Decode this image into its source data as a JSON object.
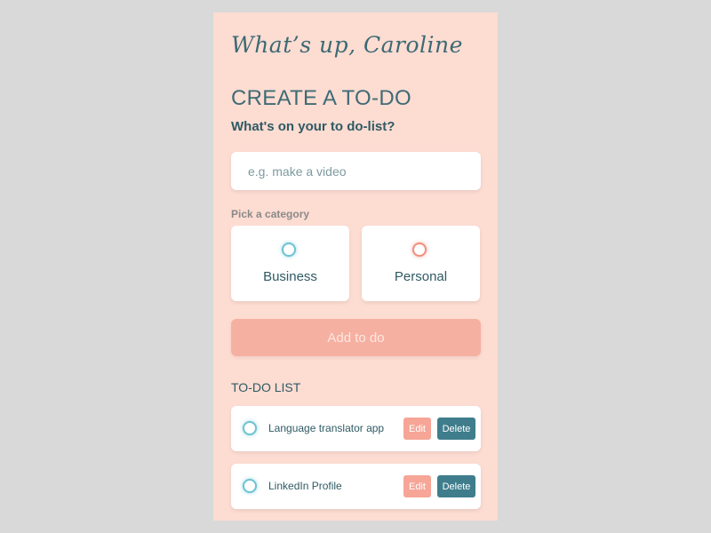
{
  "header": {
    "greeting": "What’s up, Caroline"
  },
  "create": {
    "title": "CREATE A TO-DO",
    "subtitle": "What's on your to do-list?",
    "input_placeholder": "e.g. make a video",
    "input_value": ""
  },
  "category": {
    "label": "Pick a category",
    "options": [
      {
        "label": "Business",
        "color": "#6ec3d4"
      },
      {
        "label": "Personal",
        "color": "#f08f7d"
      }
    ]
  },
  "add_button": {
    "label": "Add to do"
  },
  "todo_list": {
    "title": "TO-DO LIST",
    "items": [
      {
        "text": "Language translator app",
        "edit_label": "Edit",
        "delete_label": "Delete"
      },
      {
        "text": "LinkedIn Profile",
        "edit_label": "Edit",
        "delete_label": "Delete"
      }
    ]
  },
  "colors": {
    "page_background": "#d9d9d9",
    "app_background": "#fddcd2",
    "text_primary": "#2f5a64",
    "accent_button": "#f6b0a2",
    "edit_button": "#f6a596",
    "delete_button": "#3f7d8c"
  }
}
